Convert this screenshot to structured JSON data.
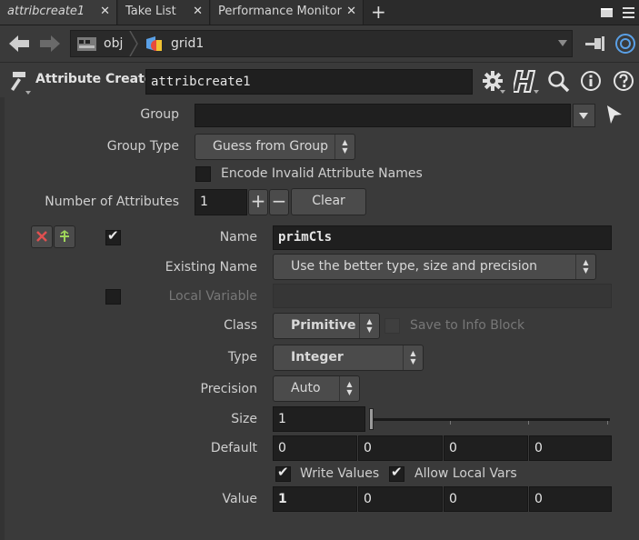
{
  "tabs": [
    {
      "label": "attribcreate1",
      "active": true
    },
    {
      "label": "Take List",
      "active": false
    },
    {
      "label": "Performance Monitor",
      "active": false
    }
  ],
  "tab_close_glyph": "✕",
  "tab_add_glyph": "+",
  "path": {
    "root": "obj",
    "node": "grid1"
  },
  "header": {
    "node_type": "Attribute Create",
    "node_name": "attribcreate1"
  },
  "params": {
    "group_label": "Group",
    "group_value": "",
    "group_type_label": "Group Type",
    "group_type_value": "Guess from Group",
    "encode_label": "Encode Invalid Attribute Names",
    "encode_checked": false,
    "num_attr_label": "Number of Attributes",
    "num_attr_value": "1",
    "clear_label": "Clear",
    "name_label": "Name",
    "name_value": "primCls",
    "name_enabled": true,
    "existing_label": "Existing Name",
    "existing_value": "Use the better type, size and precision",
    "local_var_label": "Local Variable",
    "local_var_value": "",
    "class_label": "Class",
    "class_value": "Primitive",
    "save_info_label": "Save to Info Block",
    "type_label": "Type",
    "type_value": "Integer",
    "precision_label": "Precision",
    "precision_value": "Auto",
    "size_label": "Size",
    "size_value": "1",
    "default_label": "Default",
    "default_values": [
      "0",
      "0",
      "0",
      "0"
    ],
    "write_values_label": "Write Values",
    "write_values_checked": true,
    "allow_local_label": "Allow Local Vars",
    "allow_local_checked": true,
    "value_label": "Value",
    "value_values": [
      "1",
      "0",
      "0",
      "0"
    ]
  },
  "colors": {
    "accent_red": "#d9534f",
    "accent_green": "#9fd65a",
    "node_blue": "#5aa0e6"
  }
}
